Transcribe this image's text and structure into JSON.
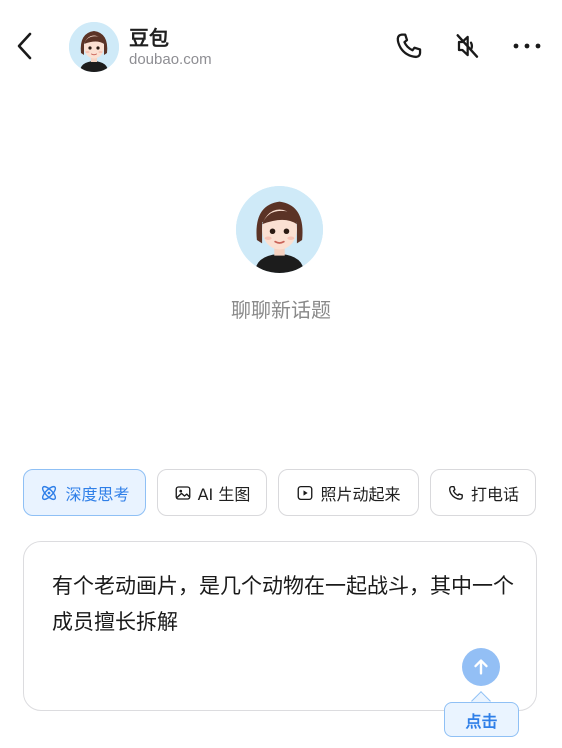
{
  "header": {
    "title": "豆包",
    "subtitle": "doubao.com",
    "back_icon": "chevron-left-icon",
    "call_icon": "phone-icon",
    "mute_icon": "speaker-muted-icon",
    "more_icon": "more-horizontal-icon"
  },
  "center": {
    "prompt": "聊聊新话题"
  },
  "chips": [
    {
      "label": "深度思考",
      "icon": "atom-icon",
      "active": true
    },
    {
      "label": "AI 生图",
      "icon": "image-icon",
      "active": false
    },
    {
      "label": "照片动起来",
      "icon": "play-square-icon",
      "active": false
    },
    {
      "label": "打电话",
      "icon": "phone-icon",
      "active": false
    }
  ],
  "input": {
    "value": "有个老动画片，是几个动物在一起战斗，其中一个成员擅长拆解"
  },
  "send": {
    "icon": "arrow-up-icon",
    "tooltip": "点击"
  },
  "colors": {
    "accent": "#2f7fe8",
    "accent_light": "#e9f3ff",
    "send_button": "#93bff5",
    "muted_text": "#8a8a8a"
  }
}
